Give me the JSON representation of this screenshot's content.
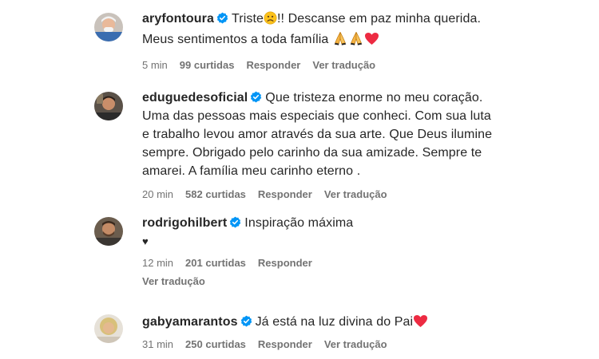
{
  "comments": [
    {
      "username": "aryfontoura",
      "text_before": "Triste",
      "text_middle": "!! Descanse em paz minha querida.",
      "text_line2": "Meus sentimentos a toda família ",
      "time": "5 min",
      "likes": "99 curtidas",
      "reply": "Responder",
      "translate": "Ver tradução"
    },
    {
      "username": "eduguedesoficial",
      "text": "Que tristeza enorme no meu coração. Uma das pessoas mais especiais que conheci. Com sua luta e trabalho levou amor através da sua arte. Que Deus ilumine sempre. Obrigado pelo carinho da sua amizade. Sempre te amarei. A família meu carinho eterno .",
      "time": "20 min",
      "likes": "582 curtidas",
      "reply": "Responder",
      "translate": "Ver tradução"
    },
    {
      "username": "rodrigohilbert",
      "text": "Inspiração máxima",
      "text_line2": "♥",
      "time": "12 min",
      "likes": "201 curtidas",
      "reply": "Responder",
      "translate": "Ver tradução"
    },
    {
      "username": "gabyamarantos",
      "text": "Já está na luz divina do Pai",
      "time": "31 min",
      "likes": "250 curtidas",
      "reply": "Responder",
      "translate": "Ver tradução"
    }
  ],
  "colors": {
    "text": "#262626",
    "meta": "#737373",
    "verified": "#0095f6",
    "heart": "#ed2b42"
  },
  "icons": [
    "verified-badge-icon",
    "sad-face-emoji",
    "praying-hands-emoji",
    "red-heart-emoji"
  ]
}
